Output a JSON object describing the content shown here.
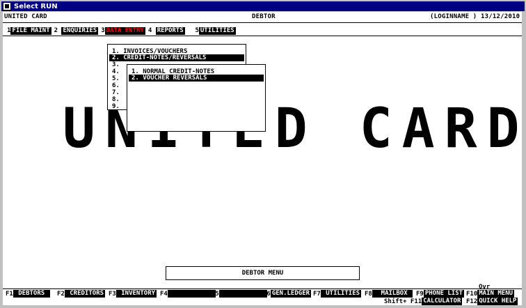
{
  "window": {
    "title": "Select RUN",
    "icon": "terminal-icon"
  },
  "header": {
    "left": "UNITED CARD",
    "middle": "DEBTOR",
    "right": "(LOGINNAME ) 13/12/2010"
  },
  "menubar": [
    {
      "num": "1",
      "label": "FILE MAINT"
    },
    {
      "num": "2",
      "label": "ENQUIRIES"
    },
    {
      "num": "3",
      "label": "DATA ENTRY",
      "active": true
    },
    {
      "num": "4",
      "label": "REPORTS"
    },
    {
      "num": "5",
      "label": "UTILITIES"
    }
  ],
  "background_logo": "UNITED CARD",
  "dropdown1": {
    "items": [
      "1. INVOICES/VOUCHERS",
      "2. CREDIT-NOTES/REVERSALS",
      "3.",
      "4.",
      "5.",
      "6.",
      "7.",
      "8.",
      "9."
    ],
    "selected_index": 1
  },
  "dropdown2": {
    "items": [
      "1. NORMAL CREDIT-NOTES",
      "2. VOUCHER REVERSALS"
    ],
    "selected_index": 1
  },
  "menu_title": "DEBTOR MENU",
  "ovr": "Ovr",
  "fkeys_row1": [
    {
      "key": "F1",
      "label": " DEBTORS "
    },
    {
      "key": "F2",
      "label": " CREDITORS"
    },
    {
      "key": "F3",
      "label": " INVENTORY"
    },
    {
      "key": "F4",
      "label": "            "
    },
    {
      "key": "F5",
      "label": "            "
    },
    {
      "key": "F6",
      "label": "GEN.LEDGER"
    },
    {
      "key": "F7",
      "label": " UTILITIES"
    },
    {
      "key": "F8",
      "label": "  MAILBOX "
    },
    {
      "key": "F9",
      "label": "PHONE LIST"
    },
    {
      "key": "F10",
      "label": "MAIN MENU"
    }
  ],
  "fkeys_row2": [
    {
      "key": "Shift+ F11",
      "label": "CALCULATOR"
    },
    {
      "key": "F12",
      "label": "QUICK HELP"
    }
  ],
  "colors": {
    "titlebar": "#000080",
    "active_menu_text": "#ff0000"
  }
}
